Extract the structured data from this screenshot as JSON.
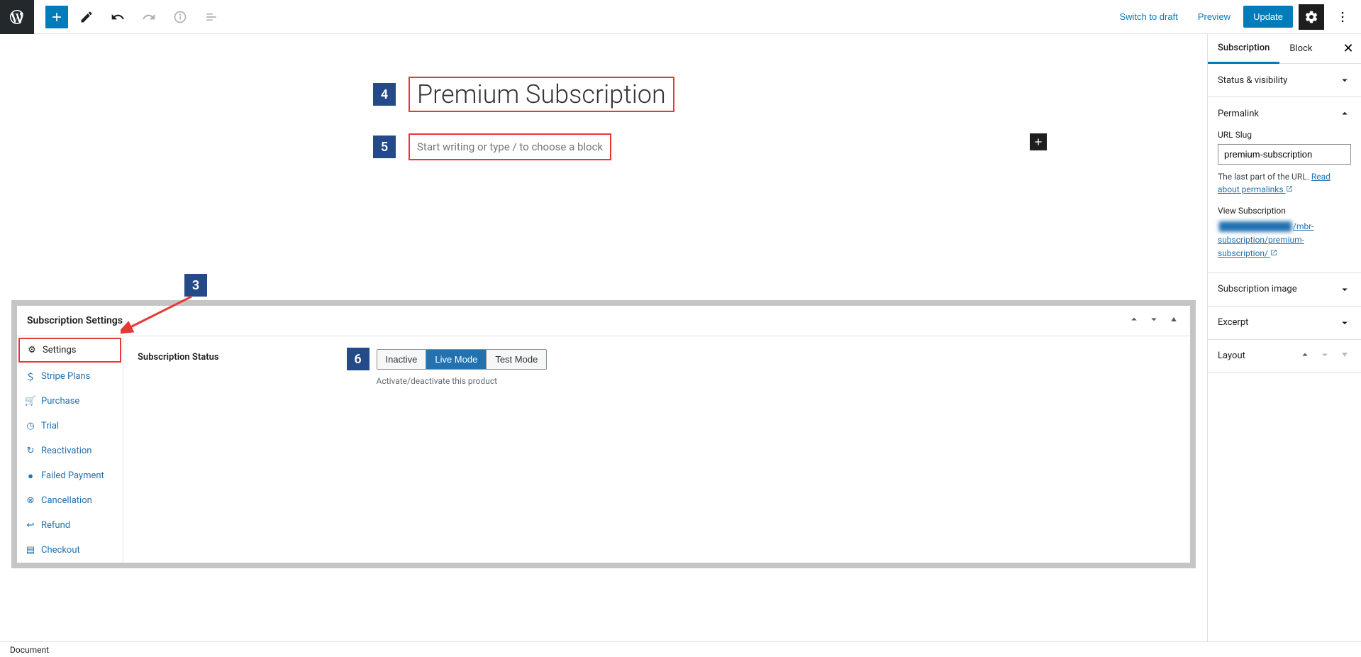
{
  "toolbar": {
    "switch_draft": "Switch to draft",
    "preview": "Preview",
    "update": "Update"
  },
  "editor": {
    "title_badge": "4",
    "title": "Premium Subscription",
    "body_badge": "5",
    "body_placeholder": "Start writing or type / to choose a block"
  },
  "settings_panel": {
    "marker_badge": "3",
    "title": "Subscription Settings",
    "tabs": [
      {
        "icon": "gear",
        "label": "Settings",
        "active": true
      },
      {
        "icon": "dollar",
        "label": "Stripe Plans"
      },
      {
        "icon": "cart",
        "label": "Purchase"
      },
      {
        "icon": "clock",
        "label": "Trial"
      },
      {
        "icon": "sync",
        "label": "Reactivation"
      },
      {
        "icon": "warn",
        "label": "Failed Payment"
      },
      {
        "icon": "cancel",
        "label": "Cancellation"
      },
      {
        "icon": "return",
        "label": "Refund"
      },
      {
        "icon": "list",
        "label": "Checkout"
      }
    ],
    "status_label": "Subscription Status",
    "status_badge": "6",
    "status_options": [
      "Inactive",
      "Live Mode",
      "Test Mode"
    ],
    "status_active_index": 1,
    "status_help": "Activate/deactivate this product"
  },
  "sidebar": {
    "tabs": [
      "Subscription",
      "Block"
    ],
    "active_tab": 0,
    "sections": {
      "status": "Status & visibility",
      "permalink": {
        "title": "Permalink",
        "slug_label": "URL Slug",
        "slug_value": "premium-subscription",
        "help_prefix": "The last part of the URL. ",
        "help_link": "Read about permalinks",
        "view_label": "View Subscription",
        "view_url_suffix": "/mbr-subscription/",
        "view_url_slug": "premium-subscription/"
      },
      "image": "Subscription image",
      "excerpt": "Excerpt",
      "layout": "Layout"
    }
  },
  "statusbar": {
    "label": "Document"
  }
}
